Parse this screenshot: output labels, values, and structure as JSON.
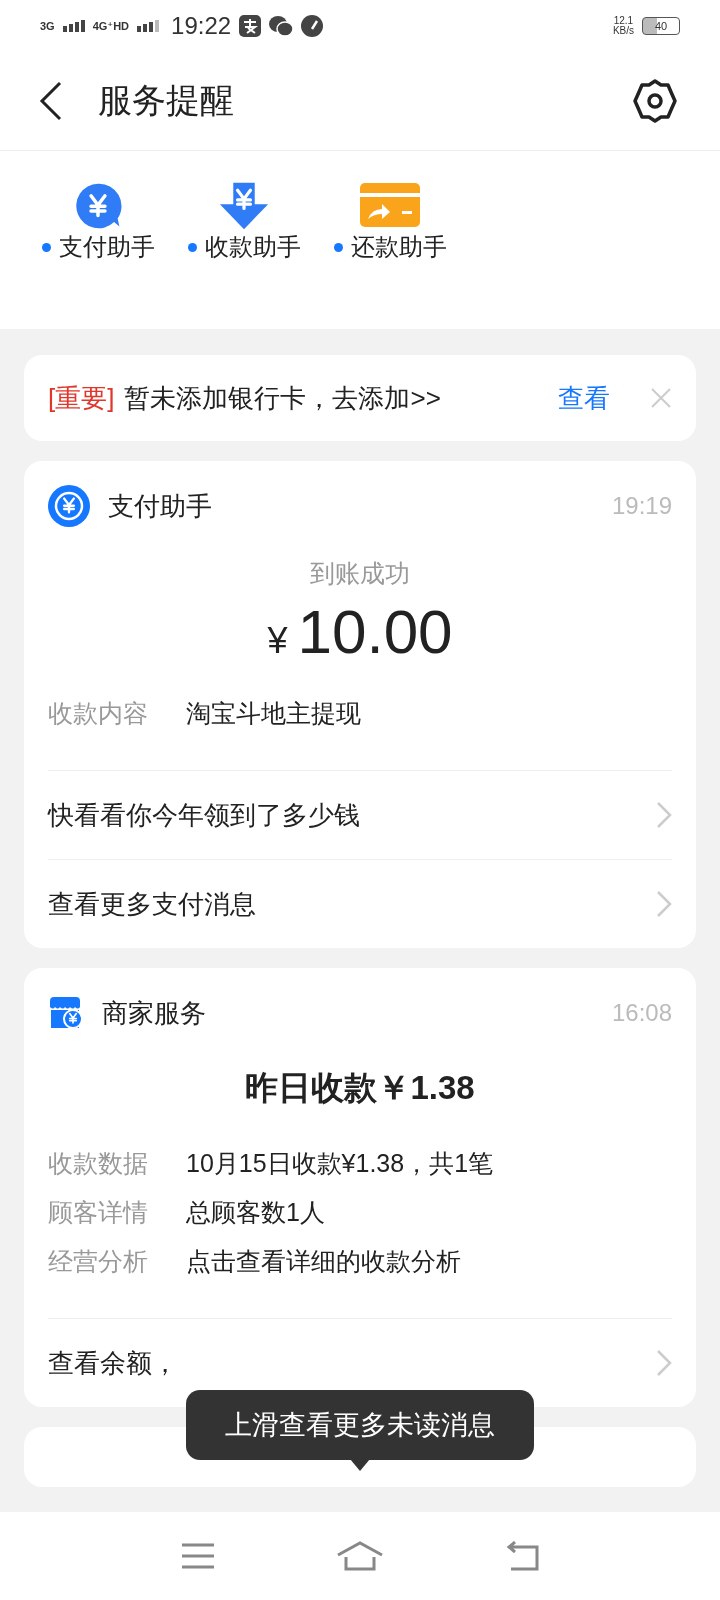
{
  "status_bar": {
    "network_1": "3G",
    "network_2": "4G⁺HD",
    "time": "19:22",
    "speed": "12.1",
    "speed_unit": "KB/s",
    "battery": "40"
  },
  "header": {
    "title": "服务提醒"
  },
  "shortcuts": [
    {
      "kind": "pay",
      "label": "支付助手",
      "unread": true
    },
    {
      "kind": "receive",
      "label": "收款助手",
      "unread": true
    },
    {
      "kind": "repay",
      "label": "还款助手",
      "unread": true
    }
  ],
  "notice": {
    "tag": "[重要]",
    "text": "暂未添加银行卡，去添加>>",
    "action": "查看"
  },
  "cards": [
    {
      "kind": "payment",
      "title": "支付助手",
      "time": "19:19",
      "status": "到账成功",
      "currency": "¥",
      "amount": "10.00",
      "details": [
        {
          "label": "收款内容",
          "value": "淘宝斗地主提现"
        }
      ],
      "links": [
        "快看看你今年领到了多少钱",
        "查看更多支付消息"
      ]
    },
    {
      "kind": "merchant",
      "title": "商家服务",
      "time": "16:08",
      "headline": "昨日收款￥1.38",
      "details": [
        {
          "label": "收款数据",
          "value": "10月15日收款¥1.38，共1笔"
        },
        {
          "label": "顾客详情",
          "value": "总顾客数1人"
        },
        {
          "label": "经营分析",
          "value": "点击查看详细的收款分析"
        }
      ],
      "links": [
        "查看余额，"
      ]
    }
  ],
  "tooltip": "上滑查看更多未读消息"
}
